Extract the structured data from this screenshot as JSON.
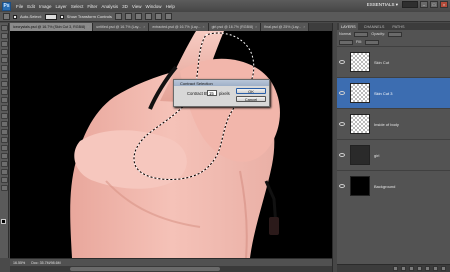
{
  "menu": {
    "logo": "Ps",
    "items": [
      "File",
      "Edit",
      "Image",
      "Layer",
      "Select",
      "Filter",
      "Analysis",
      "3D",
      "View",
      "Window",
      "Help"
    ],
    "workspace": "ESSENTIALS ▾"
  },
  "options": {
    "auto_select": "Auto-Select:",
    "transform": "Show Transform Controls"
  },
  "tabs": [
    {
      "label": "icecrystals.psd @ 16.7% (Skin Cut 3, RGB/8)",
      "active": true
    },
    {
      "label": "untitled.psd @ 16.7% (Lay...",
      "active": false
    },
    {
      "label": "extracted.psd @ 16.7% (Lay...",
      "active": false
    },
    {
      "label": "girl.psd @ 16.7% (RGB/8)",
      "active": false
    },
    {
      "label": "final.psd @ 25% (Lay...",
      "active": false
    }
  ],
  "status": {
    "zoom": "16.55%",
    "doc": "Doc: 35.7M/98.6M"
  },
  "dialog": {
    "title": "Contract Selection",
    "label": "Contract By:",
    "value": "15",
    "unit": "pixels",
    "ok": "OK",
    "cancel": "Cancel"
  },
  "layers_panel": {
    "tabs": [
      "LAYERS",
      "CHANNELS",
      "PATHS"
    ],
    "blend_mode": "Normal",
    "opacity_label": "Opacity:",
    "fill_label": "Fill:",
    "layers": [
      {
        "name": "Skin Cut",
        "thumb": "checker",
        "active": false
      },
      {
        "name": "Skin Cut 3",
        "thumb": "checker",
        "active": true
      },
      {
        "name": "Inside of body",
        "thumb": "checker",
        "active": false
      },
      {
        "name": "girl",
        "thumb": "photo",
        "active": false
      },
      {
        "name": "Background",
        "thumb": "black",
        "active": false
      }
    ]
  },
  "colors": {
    "accent": "#3c6db1",
    "canvas_bg": "#000000",
    "skin": "#f2b6ab"
  }
}
